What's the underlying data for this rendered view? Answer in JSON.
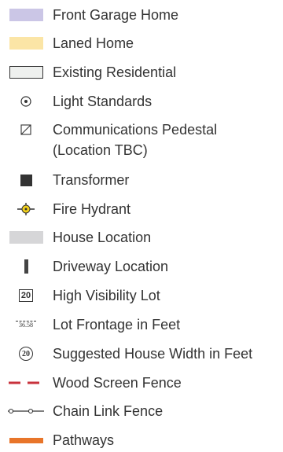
{
  "legend": {
    "items": [
      {
        "label": "Front Garage Home",
        "icon": "purple-swatch-icon",
        "color": "#cbc6e6"
      },
      {
        "label": "Laned Home",
        "icon": "yellow-swatch-icon",
        "color": "#fbe5a6"
      },
      {
        "label": "Existing Residential",
        "icon": "outlined-rectangle-icon",
        "color": "#eef0ee"
      },
      {
        "label": "Light Standards",
        "icon": "light-standard-icon"
      },
      {
        "label": "Communications Pedestal",
        "label2": "(Location TBC)",
        "icon": "communications-pedestal-icon"
      },
      {
        "label": "Transformer",
        "icon": "transformer-icon",
        "color": "#333333"
      },
      {
        "label": "Fire Hydrant",
        "icon": "fire-hydrant-icon",
        "color": "#f3d11b"
      },
      {
        "label": "House Location",
        "icon": "house-location-icon",
        "color": "#d6d6d8"
      },
      {
        "label": "Driveway Location",
        "icon": "driveway-location-icon",
        "color": "#444444"
      },
      {
        "label": "High Visibility Lot",
        "icon": "high-visibility-lot-icon",
        "symbol_text": "20"
      },
      {
        "label": "Lot Frontage in Feet",
        "icon": "lot-frontage-icon",
        "symbol_text": "36.58"
      },
      {
        "label": "Suggested House Width in Feet",
        "icon": "house-width-icon",
        "symbol_text": "20"
      },
      {
        "label": "Wood Screen Fence",
        "icon": "wood-screen-fence-icon",
        "color": "#c8323c"
      },
      {
        "label": "Chain Link Fence",
        "icon": "chain-link-fence-icon"
      },
      {
        "label": "Pathways",
        "icon": "pathways-icon",
        "color": "#e8752a"
      }
    ]
  }
}
